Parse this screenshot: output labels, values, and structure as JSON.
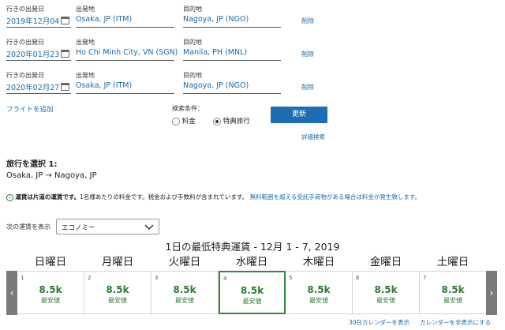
{
  "segments": [
    {
      "date_label": "行きの出発日",
      "date": "2019年12月04日",
      "from_label": "出発地",
      "from": "Osaka, JP (ITM)",
      "to_label": "目的地",
      "to": "Nagoya, JP (NGO)",
      "delete": "削除"
    },
    {
      "date_label": "行きの出発日",
      "date": "2020年01月23日",
      "from_label": "出発地",
      "from": "Ho Chi Minh City, VN (SGN)",
      "to_label": "目的地",
      "to": "Manila, PH (MNL)",
      "delete": "削除"
    },
    {
      "date_label": "行きの出発日",
      "date": "2020年02月27日",
      "from_label": "出発地",
      "from": "Osaka, JP (ITM)",
      "to_label": "目的地",
      "to": "Nagoya, JP (NGO)",
      "delete": "削除"
    }
  ],
  "add_flight": "フライトを追加",
  "search": {
    "label": "検索条件：",
    "options": [
      "料金",
      "特典旅行"
    ],
    "selected": "特典旅行",
    "update_button": "更新",
    "advanced": "詳細検索"
  },
  "trip": {
    "heading": "旅行を選択 1:",
    "route": "Osaka, JP → Nagoya, JP"
  },
  "notice": {
    "bold": "運賃は片道の運賃です。",
    "text": "1名様あたりの料金です。税金および手数料が含まれています。",
    "link": "無料範囲を超える受託手荷物がある場合は料金が発生致します。"
  },
  "fare_class": {
    "label": "次の運賃を表示",
    "value": "エコノミー"
  },
  "calendar": {
    "title": "1日の最低特典運賃 - 12月 1 - 7, 2019",
    "weekdays": [
      "日曜日",
      "月曜日",
      "火曜日",
      "水曜日",
      "木曜日",
      "金曜日",
      "土曜日"
    ],
    "days": [
      {
        "num": "1",
        "fare": "8.5k",
        "note": "最安値"
      },
      {
        "num": "2",
        "fare": "8.5k",
        "note": "最安値"
      },
      {
        "num": "3",
        "fare": "8.5k",
        "note": "最安値"
      },
      {
        "num": "4",
        "fare": "8.5k",
        "note": "最安値"
      },
      {
        "num": "5",
        "fare": "8.5k",
        "note": "最安値"
      },
      {
        "num": "6",
        "fare": "8.5k",
        "note": "最安値"
      },
      {
        "num": "7",
        "fare": "8.5k",
        "note": "最安値"
      }
    ],
    "selected_day": "4",
    "show_30day": "30日カレンダーを表示",
    "hide_calendar": "カレンダーを非表示にする"
  },
  "colors": {
    "link": "#1a6aab",
    "button": "#1c6db4",
    "fare": "#2e7d32",
    "selected_border": "#2e8b3e"
  }
}
